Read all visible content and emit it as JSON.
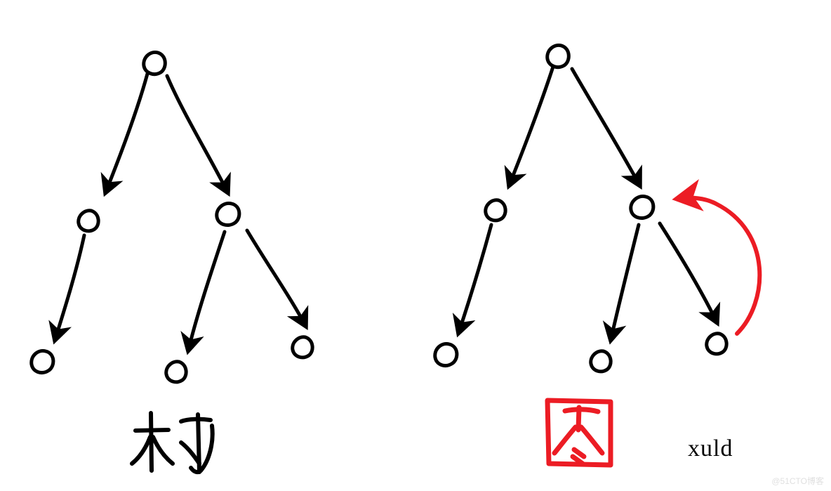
{
  "diagram": {
    "left_label": "树",
    "right_label": "图",
    "signature": "xuld",
    "watermark": "@51CTO博客",
    "colors": {
      "ink": "#000000",
      "highlight": "#ec1c24"
    },
    "structures": {
      "tree": {
        "nodes": [
          "root",
          "L",
          "R",
          "LL",
          "RL",
          "RR"
        ],
        "edges": [
          [
            "root",
            "L"
          ],
          [
            "root",
            "R"
          ],
          [
            "L",
            "LL"
          ],
          [
            "R",
            "RL"
          ],
          [
            "R",
            "RR"
          ]
        ]
      },
      "graph": {
        "nodes": [
          "root",
          "L",
          "R",
          "LL",
          "RL",
          "RR"
        ],
        "edges": [
          [
            "root",
            "L"
          ],
          [
            "root",
            "R"
          ],
          [
            "L",
            "LL"
          ],
          [
            "R",
            "RL"
          ],
          [
            "R",
            "RR"
          ],
          [
            "RR",
            "R"
          ]
        ],
        "cycle_edge": [
          "RR",
          "R"
        ]
      }
    }
  }
}
